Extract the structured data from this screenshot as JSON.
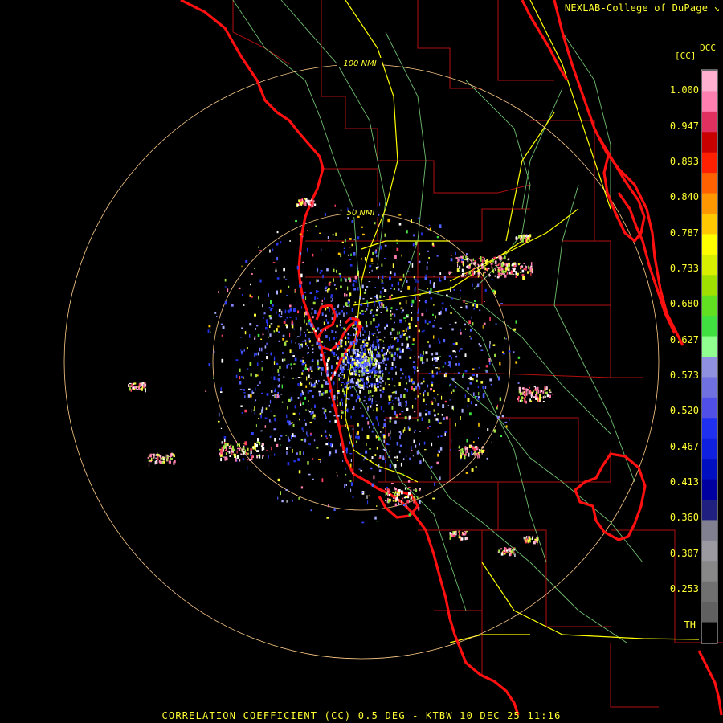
{
  "header": {
    "credit": "NEXLAB-College of DuPage",
    "credit_icon": "resize-corner-icon"
  },
  "legend": {
    "product_code": "DCC",
    "unit": "[CC]",
    "labels": [
      "1.000",
      "0.947",
      "0.893",
      "0.840",
      "0.787",
      "0.733",
      "0.680",
      "0.627",
      "0.573",
      "0.520",
      "0.467",
      "0.413",
      "0.360",
      "0.307",
      "0.253",
      "TH"
    ],
    "colors": [
      "#ffb0d0",
      "#ff80b0",
      "#e03060",
      "#c80000",
      "#ff2000",
      "#ff6000",
      "#ff9800",
      "#ffc800",
      "#ffff00",
      "#d8f000",
      "#a0e000",
      "#60e020",
      "#40e040",
      "#90ff90",
      "#9090e0",
      "#7070e0",
      "#5050e8",
      "#2030f0",
      "#1020e0",
      "#0010c0",
      "#0000a0",
      "#202080",
      "#808090",
      "#9a9aa0",
      "#888888",
      "#707070",
      "#606060",
      "#000000"
    ]
  },
  "map": {
    "range_ring_labels": [
      "100 NMI",
      "50 NMI"
    ],
    "colors": {
      "coast": "#ff1010",
      "county": "#b01010",
      "highway_major": "#ffff00",
      "highway_minor": "#70c070",
      "range_ring": "#ffcc88"
    }
  },
  "footer": {
    "text": "CORRELATION COEFFICIENT (CC) 0.5 DEG - KTBW 10 DEC 25 11:16"
  }
}
